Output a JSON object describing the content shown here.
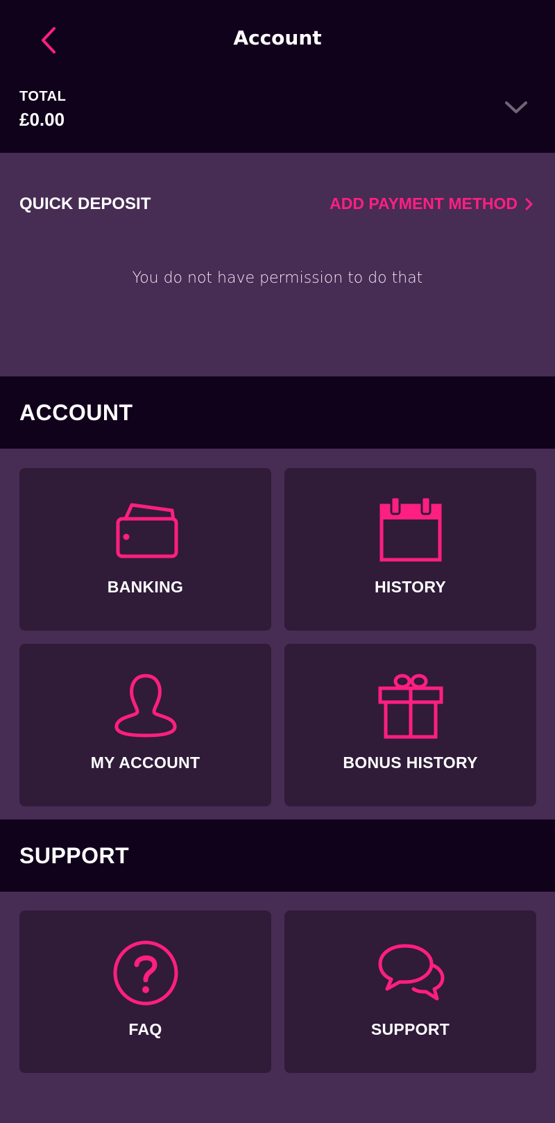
{
  "header": {
    "title": "Account",
    "total_label": "TOTAL",
    "total_value": "£0.00"
  },
  "quick_deposit": {
    "title": "QUICK DEPOSIT",
    "add_payment_label": "ADD PAYMENT METHOD",
    "message": "You do not have permission to do that"
  },
  "account_section": {
    "title": "ACCOUNT",
    "tiles": [
      {
        "label": "BANKING",
        "icon": "wallet-icon"
      },
      {
        "label": "HISTORY",
        "icon": "calendar-icon"
      },
      {
        "label": "MY ACCOUNT",
        "icon": "user-icon"
      },
      {
        "label": "BONUS HISTORY",
        "icon": "gift-icon"
      }
    ]
  },
  "support_section": {
    "title": "SUPPORT",
    "tiles": [
      {
        "label": "FAQ",
        "icon": "question-icon"
      },
      {
        "label": "SUPPORT",
        "icon": "chat-bubbles-icon"
      }
    ]
  },
  "colors": {
    "accent": "#ff1f82",
    "header_bg": "#11021c",
    "page_bg": "#472c54",
    "tile_bg": "#301b39"
  }
}
